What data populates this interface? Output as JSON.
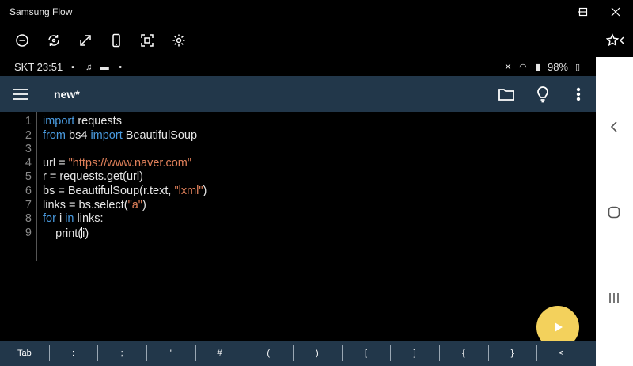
{
  "window": {
    "title": "Samsung Flow"
  },
  "toolbar": {
    "icons": [
      "minus-circle-icon",
      "rotate-icon",
      "expand-icon",
      "phone-icon",
      "screenshot-icon",
      "settings-icon"
    ],
    "right_icon": "star-favorite-icon"
  },
  "status_bar": {
    "carrier_time": "SKT 23:51",
    "battery": "98%"
  },
  "app_bar": {
    "title": "new*"
  },
  "editor": {
    "lines": [
      {
        "num": "1",
        "tokens": [
          {
            "t": "import",
            "c": "kw"
          },
          {
            "t": " requests",
            "c": ""
          }
        ]
      },
      {
        "num": "2",
        "tokens": [
          {
            "t": "from",
            "c": "kw"
          },
          {
            "t": " bs4 ",
            "c": ""
          },
          {
            "t": "import",
            "c": "kw"
          },
          {
            "t": " BeautifulSoup",
            "c": ""
          }
        ]
      },
      {
        "num": "3",
        "tokens": []
      },
      {
        "num": "4",
        "tokens": [
          {
            "t": "url = ",
            "c": ""
          },
          {
            "t": "\"https://www.naver.com\"",
            "c": "str"
          }
        ]
      },
      {
        "num": "5",
        "tokens": [
          {
            "t": "r = requests.get(url)",
            "c": ""
          }
        ]
      },
      {
        "num": "6",
        "tokens": [
          {
            "t": "bs = BeautifulSoup(r.text, ",
            "c": ""
          },
          {
            "t": "\"lxml\"",
            "c": "str"
          },
          {
            "t": ")",
            "c": ""
          }
        ]
      },
      {
        "num": "7",
        "tokens": [
          {
            "t": "links = bs.select(",
            "c": ""
          },
          {
            "t": "\"a\"",
            "c": "str"
          },
          {
            "t": ")",
            "c": ""
          }
        ]
      },
      {
        "num": "8",
        "tokens": [
          {
            "t": "for",
            "c": "kw"
          },
          {
            "t": " i ",
            "c": ""
          },
          {
            "t": "in",
            "c": "kw"
          },
          {
            "t": " links:",
            "c": ""
          }
        ]
      },
      {
        "num": "9",
        "tokens": [
          {
            "t": "    print(",
            "c": ""
          },
          {
            "t": "CARET",
            "c": "caret"
          },
          {
            "t": "i)",
            "c": ""
          }
        ]
      }
    ]
  },
  "keys": [
    "Tab",
    ":",
    ";",
    "'",
    "#",
    "(",
    ")",
    "[",
    "]",
    "{",
    "}",
    "<"
  ],
  "colors": {
    "app_bar": "#22374a",
    "keyword": "#4a9be0",
    "string": "#e0805a",
    "fab": "#f3d15c"
  }
}
